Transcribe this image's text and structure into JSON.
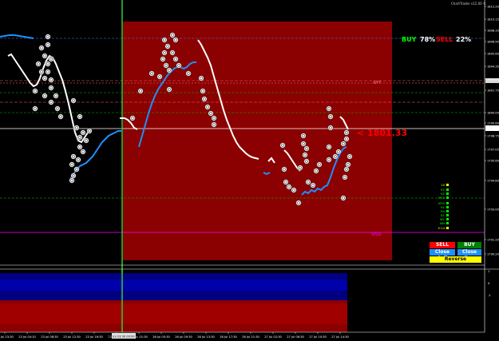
{
  "header": {
    "copyright": "ChartTrader v12.00 ©",
    "buy_label": "BUY",
    "buy_value": "78%",
    "sell_label": "SELL",
    "sell_value": "22%"
  },
  "price_marker": "< 1801.33",
  "levels": {
    "wff_label": "WFF",
    "wssi_label": "WSSI"
  },
  "buttons": {
    "sell": "SELL",
    "buy": "BUY",
    "close_sell": "Close Sell",
    "close_buy": "Close Buy",
    "reverse": "Reverse"
  },
  "timeframes": [
    {
      "label": "15",
      "color": "#ffff00"
    },
    {
      "label": "H1",
      "color": "#00ff00"
    },
    {
      "label": "H2",
      "color": "#00ff00"
    },
    {
      "label": "M15",
      "color": "#00ff00"
    },
    {
      "label": "M30",
      "color": "#00ff00"
    },
    {
      "label": "H1",
      "color": "#00ff00"
    },
    {
      "label": "H4",
      "color": "#00ff00"
    },
    {
      "label": "D1",
      "color": "#00ff00"
    },
    {
      "label": "W1",
      "color": "#00ff00"
    },
    {
      "label": "MN",
      "color": "#00ff00"
    },
    {
      "label": "5:14",
      "color": "#ffff00"
    }
  ],
  "price_axis": [
    "1812.20",
    "1810.15",
    "1808.10",
    "1806.90",
    "1805.60",
    "1804.35",
    "1803.05",
    "1801.75",
    "1800.00",
    "1799.60",
    "1798.75",
    "1797.05",
    "1795.60",
    "1794.80",
    "1793.00",
    "1791.20",
    "1790.20"
  ],
  "time_axis": [
    "22 Jul 23:30",
    "23 Jul 04:10",
    "23 Jul 08:30",
    "23 Jul 12:30",
    "23 Jul 16:30",
    "23 Jul 21:30",
    "26 Jul 01:30",
    "26 Jul 05:30",
    "26 Jul 09:30",
    "26 Jul 13:30",
    "26 Jul 17:30",
    "26 Jul 21:30",
    "27 Jul 02:30",
    "27 Jul 06:30",
    "27 Jul 10:30",
    "27 Jul 14:30"
  ],
  "cursor_time_label": "23 Jul 23:30 00:00 28",
  "sub_panel_axis": [
    "1",
    "0",
    "-1"
  ],
  "colors": {
    "zone_red": "#8b0000",
    "line_white": "#ffffff",
    "line_blue": "#1e90ff",
    "vline_green": "#32cd32",
    "wff_line": "#ff6060",
    "wssi_line": "#ff00ff",
    "indicator_navy": "#000080",
    "indicator_red": "#8b0000"
  }
}
